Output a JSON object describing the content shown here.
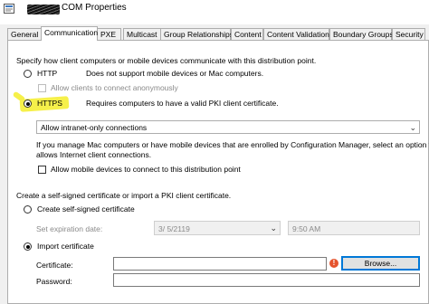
{
  "window": {
    "title": "COM Properties"
  },
  "tabs": [
    "General",
    "Communication",
    "PXE",
    "Multicast",
    "Group Relationships",
    "Content",
    "Content Validation",
    "Boundary Groups",
    "Security"
  ],
  "communication": {
    "intro": "Specify how client computers or mobile devices communicate with this distribution point.",
    "http_label": "HTTP",
    "http_desc": "Does not support mobile devices or Mac computers.",
    "allow_anonymous": "Allow clients to connect anonymously",
    "https_label": "HTTPS",
    "https_desc": "Requires computers to have a valid PKI client certificate.",
    "connection_select": "Allow intranet-only connections",
    "mac_note_1": "If you manage Mac computers or have mobile devices that are enrolled by Configuration Manager, select an option that",
    "mac_note_2": "allows Internet client connections.",
    "allow_mobile": "Allow mobile devices to connect to this distribution point"
  },
  "certificate": {
    "intro": "Create a self-signed certificate or import a PKI client certificate.",
    "self_signed": "Create self-signed certificate",
    "expiration_label": "Set expiration date:",
    "expiration_date": "3/  5/2119",
    "expiration_time": "9:50 AM",
    "import_label": "Import certificate",
    "cert_label": "Certificate:",
    "cert_value": "",
    "browse": "Browse...",
    "password_label": "Password:",
    "password_value": "",
    "error_glyph": "!"
  },
  "icons": {
    "title": "properties-icon",
    "dropdown": "chevron-down-icon",
    "error": "error-icon"
  },
  "colors": {
    "highlight": "#f6f04a",
    "focus": "#0078d7",
    "error": "#e5532d"
  }
}
